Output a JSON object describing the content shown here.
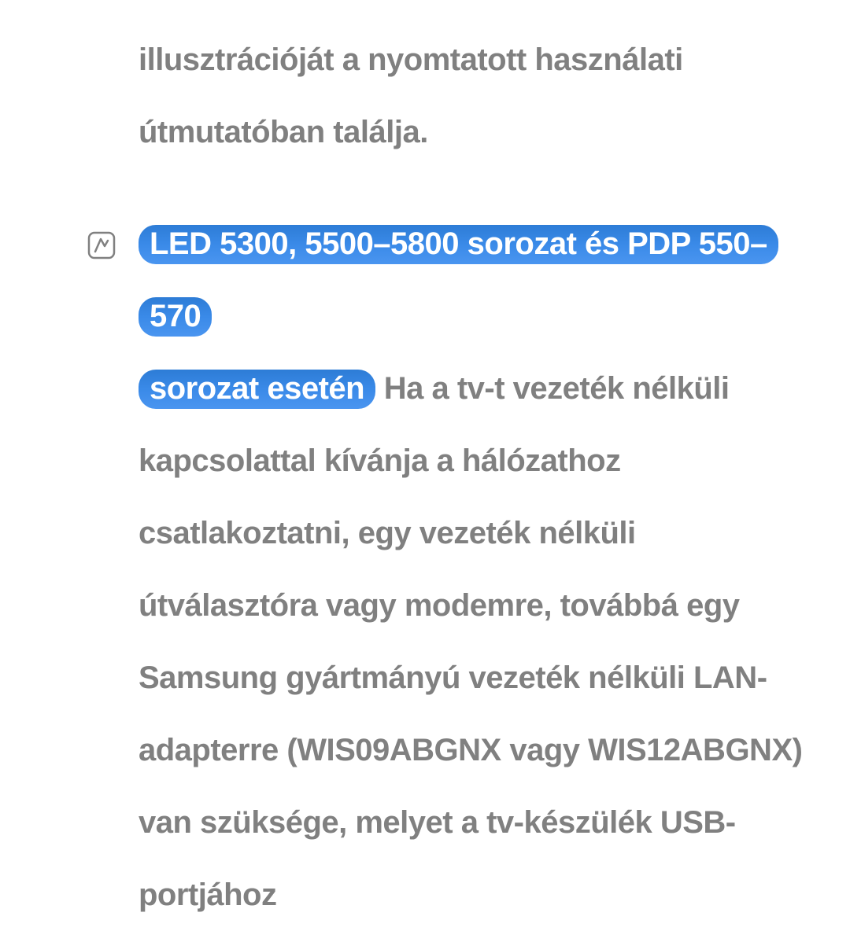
{
  "paragraph1": "illusztrációját a nyomtatott használati útmutatóban találja.",
  "highlight1": "LED 5300, 5500–5800 sorozat és PDP 550–570",
  "highlight2": "sorozat esetén",
  "paragraph2_after": " Ha a tv-t vezeték nélküli kapcsolattal kívánja a hálózathoz csatlakoztatni, egy vezeték nélküli útválasztóra vagy modemre, továbbá egy Samsung gyártmányú vezeték nélküli LAN-adapterre (WIS09ABGNX vagy WIS12ABGNX) van szüksége, melyet a tv-készülék USB-portjához"
}
